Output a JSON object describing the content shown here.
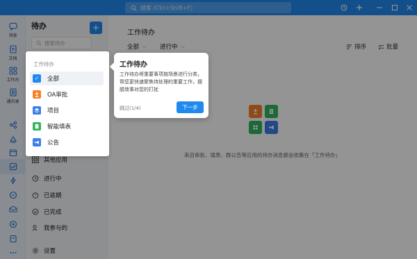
{
  "titlebar": {
    "search_placeholder": "搜索 (Ctrl+Shift+F)",
    "controls": [
      "history-icon",
      "plus-icon",
      "minimize-icon",
      "maximize-icon",
      "close-icon"
    ]
  },
  "rail": {
    "items": [
      {
        "label": "消息",
        "icon": "message-icon"
      },
      {
        "label": "文档",
        "icon": "document-icon"
      },
      {
        "label": "工作台",
        "icon": "workbench-icon"
      },
      {
        "label": "通讯录",
        "icon": "contacts-icon"
      }
    ],
    "extra_icons": [
      "share-icon",
      "cloud-icon",
      "calendar-icon",
      "todo-icon",
      "flash-icon",
      "meeting-icon",
      "mail-icon",
      "minutes-icon",
      "docs-icon",
      "more-icon"
    ]
  },
  "list": {
    "title": "待办",
    "search_placeholder": "搜索待办",
    "categories": [
      {
        "label": "其他应用"
      },
      {
        "label": "进行中"
      },
      {
        "label": "已逾期"
      },
      {
        "label": "已完成"
      },
      {
        "label": "我参与的"
      },
      {
        "label": "设置"
      }
    ]
  },
  "main": {
    "title": "工作待办",
    "filter_all": "全部",
    "filter_status": "进行中",
    "sort_label": "排序",
    "batch_label": "批量",
    "empty_text": "来自审批、填表、群公告等应用的待办消息都会收集在「工作待办」"
  },
  "menu": {
    "section_label": "工作待办",
    "items": [
      {
        "label": "全部",
        "color": "#1f89ef",
        "selected": true
      },
      {
        "label": "OA审批",
        "color": "#f5822a"
      },
      {
        "label": "项目",
        "color": "#3c7fe8"
      },
      {
        "label": "智能填表",
        "color": "#2db55d"
      },
      {
        "label": "公告",
        "color": "#3c7fe8"
      }
    ]
  },
  "tooltip": {
    "title": "工作待办",
    "body": "工作待办将重要事项按场景进行分类，帮您更快速聚焦待处理的重要工作，摆脱琐事对您的打扰",
    "skip": "跳过(1/4)",
    "next": "下一步"
  },
  "colors": {
    "accent": "#1f89ef",
    "orange": "#f5822a",
    "green": "#2db55d",
    "blue": "#3c7fe8"
  }
}
